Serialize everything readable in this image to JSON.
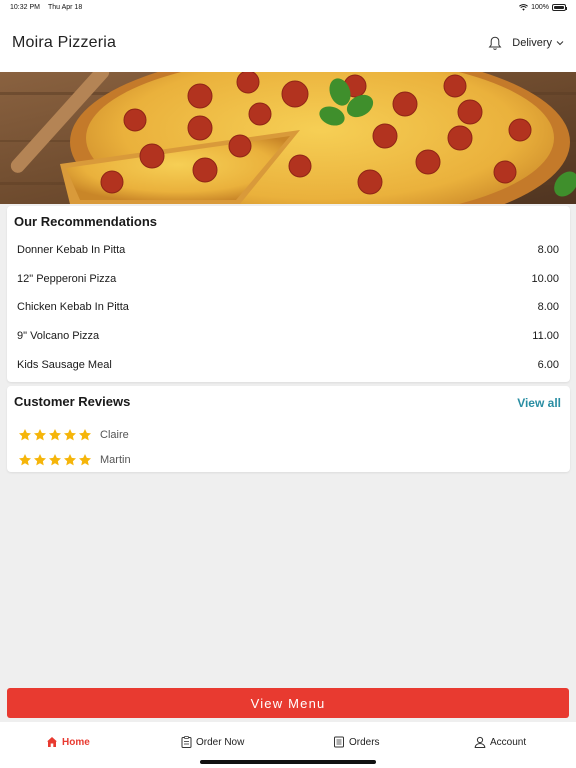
{
  "status_bar": {
    "time": "10:32 PM",
    "date": "Thu Apr 18",
    "battery_text": "100%",
    "battery_level": 1.0
  },
  "header": {
    "title": "Moira Pizzeria",
    "mode_label": "Delivery",
    "icons": [
      "bell-icon",
      "chevron-down-icon"
    ]
  },
  "hero": {
    "icon": "pizza-photo"
  },
  "recommendations": {
    "title": "Our Recommendations",
    "items": [
      {
        "name": "Donner Kebab In Pitta",
        "price": "8.00"
      },
      {
        "name": "12\" Pepperoni Pizza",
        "price": "10.00"
      },
      {
        "name": "Chicken Kebab In Pitta",
        "price": "8.00"
      },
      {
        "name": "9\" Volcano Pizza",
        "price": "11.00"
      },
      {
        "name": "Kids Sausage Meal",
        "price": "6.00"
      }
    ]
  },
  "reviews": {
    "title": "Customer Reviews",
    "view_all_label": "View all",
    "items": [
      {
        "name": "Claire",
        "rating": 5
      },
      {
        "name": "Martin",
        "rating": 5
      }
    ],
    "star_color": "#f5b50a"
  },
  "actions": {
    "view_menu_label": "View Menu",
    "accent_color": "#e83a30"
  },
  "tabbar": {
    "tabs": [
      {
        "label": "Home",
        "icon": "home-icon",
        "active": true
      },
      {
        "label": "Order Now",
        "icon": "clipboard-icon",
        "active": false
      },
      {
        "label": "Orders",
        "icon": "receipt-icon",
        "active": false
      },
      {
        "label": "Account",
        "icon": "user-icon",
        "active": false
      }
    ]
  }
}
